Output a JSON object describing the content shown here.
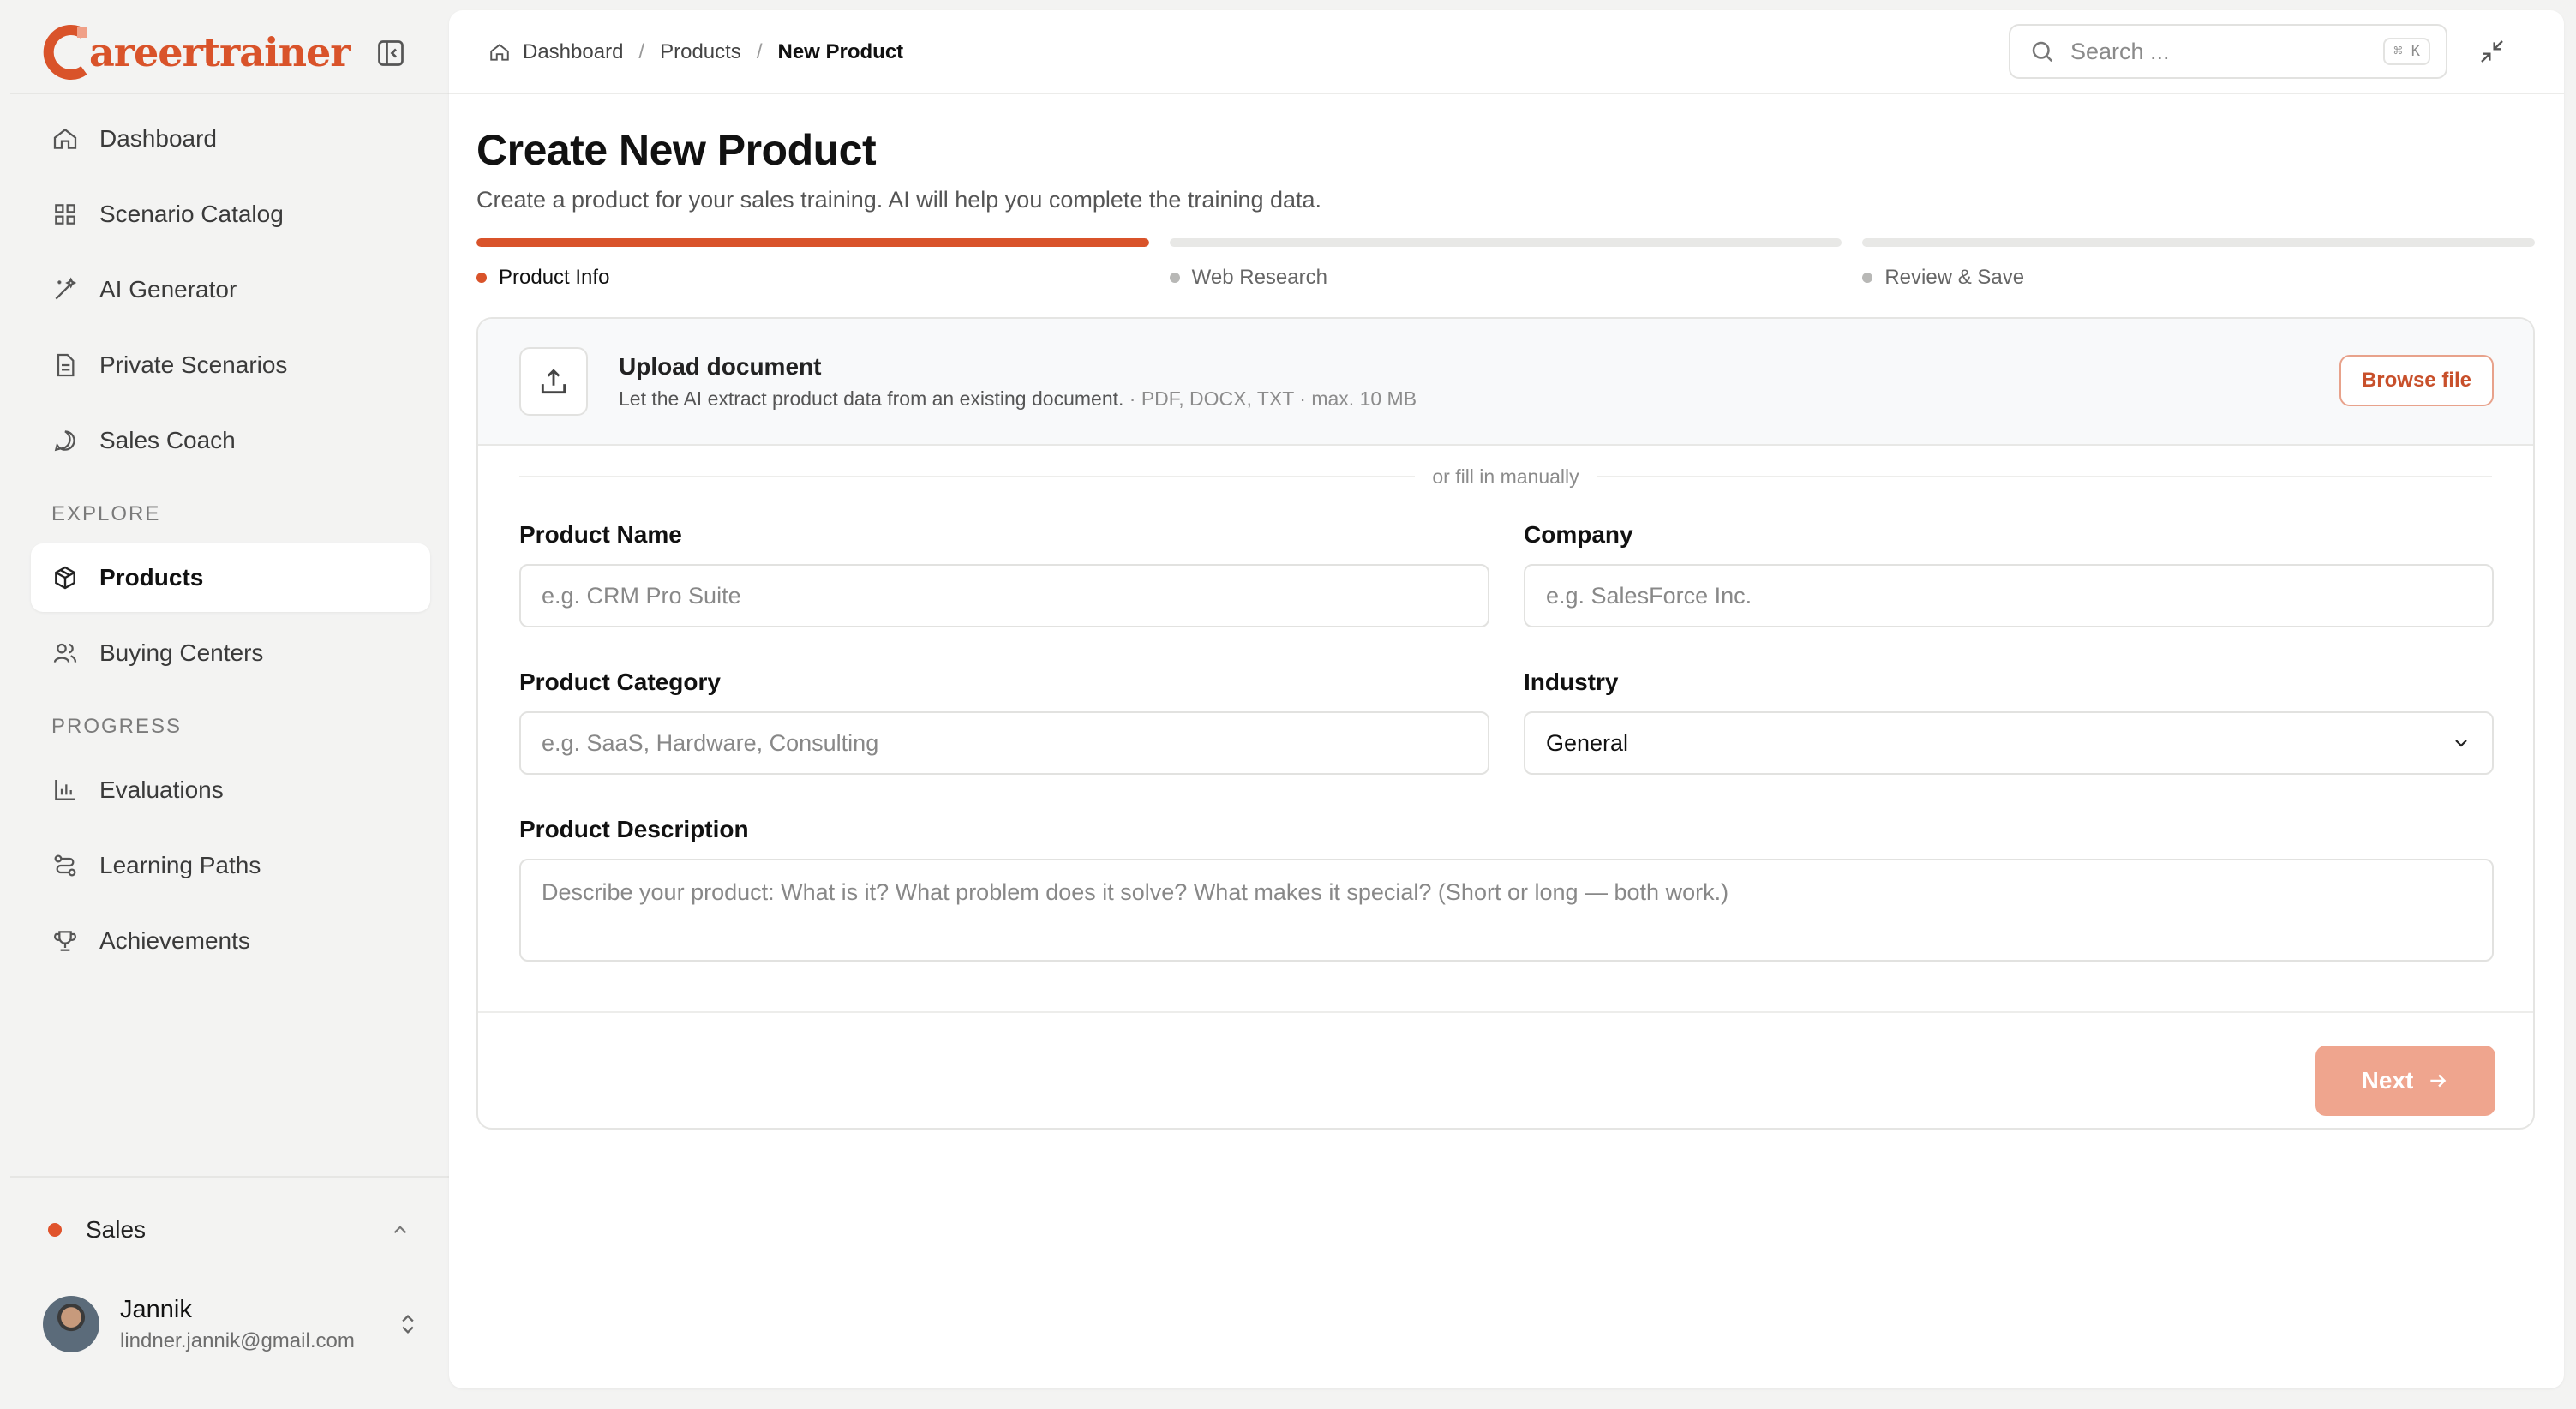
{
  "brand": {
    "name": "areertrainer",
    "accent": "#d9532a"
  },
  "sidebar": {
    "main_items": [
      {
        "label": "Dashboard",
        "icon": "home-icon"
      },
      {
        "label": "Scenario Catalog",
        "icon": "grid-icon"
      },
      {
        "label": "AI Generator",
        "icon": "magic-wand-icon"
      },
      {
        "label": "Private Scenarios",
        "icon": "document-icon"
      },
      {
        "label": "Sales Coach",
        "icon": "chat-bubble-icon"
      }
    ],
    "explore_label": "EXPLORE",
    "explore_items": [
      {
        "label": "Products",
        "icon": "package-icon",
        "active": true
      },
      {
        "label": "Buying Centers",
        "icon": "users-icon"
      }
    ],
    "progress_label": "PROGRESS",
    "progress_items": [
      {
        "label": "Evaluations",
        "icon": "bar-chart-icon"
      },
      {
        "label": "Learning Paths",
        "icon": "route-icon"
      },
      {
        "label": "Achievements",
        "icon": "trophy-icon"
      }
    ],
    "workspace": {
      "label": "Sales",
      "color": "#e0532c"
    },
    "user": {
      "name": "Jannik",
      "email": "lindner.jannik@gmail.com"
    }
  },
  "topbar": {
    "breadcrumb": [
      "Dashboard",
      "Products",
      "New Product"
    ],
    "search_placeholder": "Search ...",
    "search_shortcut": "⌘ K"
  },
  "page": {
    "title": "Create New Product",
    "subtitle": "Create a product for your sales training. AI will help you complete the training data."
  },
  "steps": [
    {
      "label": "Product Info",
      "progress": 1,
      "active": true
    },
    {
      "label": "Web Research",
      "progress": 0,
      "active": false
    },
    {
      "label": "Review & Save",
      "progress": 0,
      "active": false
    }
  ],
  "upload": {
    "title": "Upload document",
    "description": "Let the AI extract product data from an existing document.",
    "hint": " · PDF, DOCX, TXT · max. 10 MB",
    "browse_label": "Browse file"
  },
  "form": {
    "divider_text": "or fill in manually",
    "product_name": {
      "label": "Product Name",
      "placeholder": "e.g. CRM Pro Suite"
    },
    "company": {
      "label": "Company",
      "placeholder": "e.g. SalesForce Inc."
    },
    "product_category": {
      "label": "Product Category",
      "placeholder": "e.g. SaaS, Hardware, Consulting"
    },
    "industry": {
      "label": "Industry",
      "value": "General"
    },
    "product_description": {
      "label": "Product Description",
      "placeholder": "Describe your product: What is it? What problem does it solve? What makes it special? (Short or long — both work.)"
    },
    "next_label": "Next"
  }
}
